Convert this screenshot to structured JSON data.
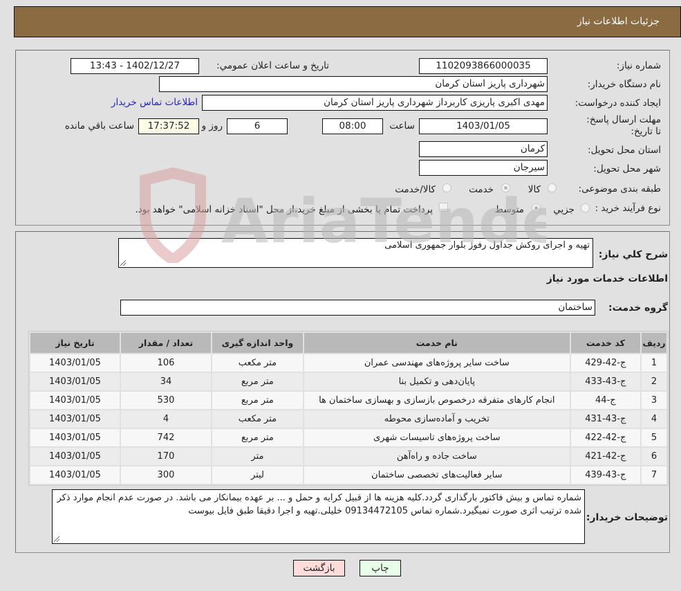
{
  "header": {
    "title": "جزئیات اطلاعات نیاز"
  },
  "details": {
    "need_number_label": "شماره نیاز:",
    "need_number": "1102093866000035",
    "announce_label": "تاریخ و ساعت اعلان عمومي:",
    "announce_value": "1402/12/27 - 13:43",
    "buyer_org_label": "نام دستگاه خریدار:",
    "buyer_org": "شهرداری پاریز استان کرمان",
    "creator_label": "ایجاد کننده درخواست:",
    "creator": "مهدی اکبری پاریزی کاربرداز شهرداری پاریز استان کرمان",
    "contact_link": "اطلاعات تماس خریدار",
    "deadline_label": "مهلت ارسال پاسخ: تا تاریخ:",
    "deadline_date": "1403/01/05",
    "time_label": "ساعت",
    "deadline_time": "08:00",
    "days_value": "6",
    "days_label": "روز و",
    "remaining_time": "17:37:52",
    "remaining_label": "ساعت باقي مانده",
    "province_label": "استان محل تحویل:",
    "province": "کرمان",
    "city_label": "شهر محل تحویل:",
    "city": "سیرجان",
    "category_label": "طبقه بندی موضوعی:",
    "category_options": [
      {
        "label": "کالا",
        "selected": false
      },
      {
        "label": "خدمت",
        "selected": true
      },
      {
        "label": "کالا/خدمت",
        "selected": false
      }
    ],
    "process_label": "نوع فرآیند خرید :",
    "process_options": [
      {
        "label": "جزيي",
        "selected": false
      },
      {
        "label": "متوسط",
        "selected": true
      }
    ],
    "treasury_checkbox_label": "پرداخت تمام یا بخشی از مبلغ خرید،از محل \"اسناد خزانه اسلامی\" خواهد بود."
  },
  "description": {
    "label": "شرح کلي نیاز:",
    "value": "تهیه و اجرای روکش جداول رفوژ بلوار جمهوری اسلامی"
  },
  "services": {
    "section_title": "اطلاعات خدمات مورد نیاز",
    "group_label": "گروه خدمت:",
    "group_value": "ساختمان",
    "columns": [
      "ردیف",
      "کد خدمت",
      "نام خدمت",
      "واحد اندازه گیری",
      "تعداد / مقدار",
      "تاریخ نیاز"
    ],
    "rows": [
      {
        "idx": "1",
        "code": "ج-42-429",
        "name": "ساخت سایر پروژه‌های مهندسی عمران",
        "unit": "متر مکعب",
        "qty": "106",
        "date": "1403/01/05"
      },
      {
        "idx": "2",
        "code": "ج-43-433",
        "name": "پایان‌دهی و تکمیل بنا",
        "unit": "متر مربع",
        "qty": "34",
        "date": "1403/01/05"
      },
      {
        "idx": "3",
        "code": "ج-44",
        "name": "انجام کارهای متفرقه درخصوص بازسازی و بهسازی ساختمان ها",
        "unit": "متر مربع",
        "qty": "530",
        "date": "1403/01/05"
      },
      {
        "idx": "4",
        "code": "ج-43-431",
        "name": "تخریب و آماده‌سازی محوطه",
        "unit": "متر مکعب",
        "qty": "4",
        "date": "1403/01/05"
      },
      {
        "idx": "5",
        "code": "ج-42-422",
        "name": "ساخت پروژه‌های تاسیسات شهری",
        "unit": "متر مربع",
        "qty": "742",
        "date": "1403/01/05"
      },
      {
        "idx": "6",
        "code": "ج-42-421",
        "name": "ساخت جاده و راه‌آهن",
        "unit": "متر",
        "qty": "170",
        "date": "1403/01/05"
      },
      {
        "idx": "7",
        "code": "ج-43-439",
        "name": "سایر فعالیت‌های تخصصی ساختمان",
        "unit": "لیتر",
        "qty": "300",
        "date": "1403/01/05"
      }
    ]
  },
  "buyer_notes": {
    "label": "توضیحات خریدار:",
    "value": "شماره تماس و بیش فاکتور بارگذاری گردد.کلیه هزینه ها از قبیل کرایه و حمل و ... بر عهده بیمانکار می باشد. در صورت عدم انجام  موارد ذکر شده ترتیب اثری صورت نمیگیرد.شماره تماس 09134472105 خلیلی.تهیه و اجرا دقیقا طبق فایل بیوست"
  },
  "buttons": {
    "print": "چاپ",
    "back": "بازگشت"
  },
  "watermark": {
    "text": "AriaTender.neT"
  }
}
